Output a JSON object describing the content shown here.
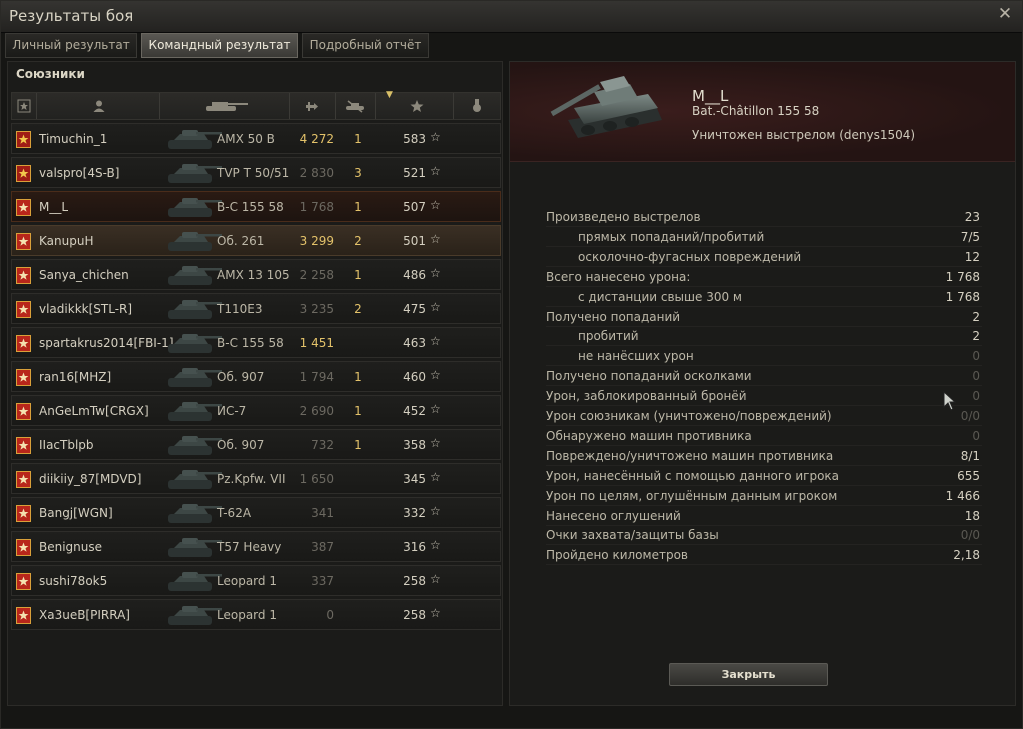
{
  "window": {
    "title": "Результаты боя",
    "close_glyph": "✕"
  },
  "tabs": [
    {
      "label": "Личный результат",
      "active": false
    },
    {
      "label": "Командный результат",
      "active": true
    },
    {
      "label": "Подробный отчёт",
      "active": false
    }
  ],
  "team": {
    "label": "Союзники",
    "columns": [
      "rank-icon",
      "player-icon",
      "tank-icon",
      "damage-icon",
      "kills-icon",
      "xp-icon",
      "medal-icon"
    ],
    "rows": [
      {
        "player": "Timuchin_1",
        "tank": "AMX 50 B",
        "damage": "4 272",
        "dmg_hi": true,
        "kills": "1",
        "xp": "583",
        "badge": "gold"
      },
      {
        "player": "valspro[4S-B]",
        "tank": "TVP T 50/51",
        "damage": "2 830",
        "dmg_hi": false,
        "kills": "3",
        "xp": "521",
        "badge": "gold"
      },
      {
        "player": "M__L",
        "tank": "B-C 155 58",
        "damage": "1 768",
        "dmg_hi": false,
        "kills": "1",
        "xp": "507",
        "badge": "red"
      },
      {
        "player": "KanupuH",
        "tank": "Об. 261",
        "damage": "3 299",
        "dmg_hi": true,
        "kills": "2",
        "xp": "501",
        "badge": "red"
      },
      {
        "player": "Sanya_chichen",
        "tank": "AMX 13 105",
        "damage": "2 258",
        "dmg_hi": false,
        "kills": "1",
        "xp": "486",
        "badge": "red"
      },
      {
        "player": "vladikkk[STL-R]",
        "tank": "T110E3",
        "damage": "3 235",
        "dmg_hi": false,
        "kills": "2",
        "xp": "475",
        "badge": "red"
      },
      {
        "player": "spartakrus2014[FBI-1]",
        "tank": "B-C 155 58",
        "damage": "1 451",
        "dmg_hi": true,
        "kills": "",
        "xp": "463",
        "badge": "red"
      },
      {
        "player": "ran16[MHZ]",
        "tank": "Об. 907",
        "damage": "1 794",
        "dmg_hi": false,
        "kills": "1",
        "xp": "460",
        "badge": "red"
      },
      {
        "player": "AnGeLmTw[CRGX]",
        "tank": "ИС-7",
        "damage": "2 690",
        "dmg_hi": false,
        "kills": "1",
        "xp": "452",
        "badge": "red"
      },
      {
        "player": "IIacTblpb",
        "tank": "Об. 907",
        "damage": "732",
        "dmg_hi": false,
        "kills": "1",
        "xp": "358",
        "badge": "red"
      },
      {
        "player": "diikiiy_87[MDVD]",
        "tank": "Pz.Kpfw. VII",
        "damage": "1 650",
        "dmg_hi": false,
        "kills": "",
        "xp": "345",
        "badge": "red"
      },
      {
        "player": "Bangj[WGN]",
        "tank": "T-62A",
        "damage": "341",
        "dmg_hi": false,
        "kills": "",
        "xp": "332",
        "badge": "red"
      },
      {
        "player": "Benignuse",
        "tank": "T57 Heavy",
        "damage": "387",
        "dmg_hi": false,
        "kills": "",
        "xp": "316",
        "badge": "red"
      },
      {
        "player": "sushi78ok5",
        "tank": "Leopard 1",
        "damage": "337",
        "dmg_hi": false,
        "kills": "",
        "xp": "258",
        "badge": "red"
      },
      {
        "player": "Xa3ueB[PIRRA]",
        "tank": "Leopard 1",
        "damage": "0",
        "dmg_hi": false,
        "kills": "",
        "xp": "258",
        "badge": "red"
      }
    ],
    "star_glyph": "☆"
  },
  "detail": {
    "player": "M__L",
    "tank": "Bat.-Châtillon 155 58",
    "status": "Уничтожен выстрелом (denys1504)",
    "stats": [
      {
        "label": "Произведено выстрелов",
        "value": "23",
        "indent": false,
        "dim": false
      },
      {
        "label": "прямых попаданий/пробитий",
        "value": "7/5",
        "indent": true,
        "dim": false
      },
      {
        "label": "осколочно-фугасных повреждений",
        "value": "12",
        "indent": true,
        "dim": false
      },
      {
        "label": "Всего нанесено урона:",
        "value": "1 768",
        "indent": false,
        "dim": false
      },
      {
        "label": "с дистанции свыше 300 м",
        "value": "1 768",
        "indent": true,
        "dim": false
      },
      {
        "label": "Получено попаданий",
        "value": "2",
        "indent": false,
        "dim": false
      },
      {
        "label": "пробитий",
        "value": "2",
        "indent": true,
        "dim": false
      },
      {
        "label": "не нанёсших урон",
        "value": "0",
        "indent": true,
        "dim": true
      },
      {
        "label": "Получено попаданий осколками",
        "value": "0",
        "indent": false,
        "dim": true
      },
      {
        "label": "Урон, заблокированный бронёй",
        "value": "0",
        "indent": false,
        "dim": true
      },
      {
        "label": "Урон союзникам (уничтожено/повреждений)",
        "value": "0/0",
        "indent": false,
        "dim": true
      },
      {
        "label": "Обнаружено машин противника",
        "value": "0",
        "indent": false,
        "dim": true
      },
      {
        "label": "Повреждено/уничтожено машин противника",
        "value": "8/1",
        "indent": false,
        "dim": false
      },
      {
        "label": "Урон, нанесённый с помощью данного игрока",
        "value": "655",
        "indent": false,
        "dim": false
      },
      {
        "label": "Урон по целям, оглушённым данным игроком",
        "value": "1 466",
        "indent": false,
        "dim": false
      },
      {
        "label": "Нанесено оглушений",
        "value": "18",
        "indent": false,
        "dim": false
      },
      {
        "label": "Очки захвата/защиты базы",
        "value": "0/0",
        "indent": false,
        "dim": true
      },
      {
        "label": "Пройдено километров",
        "value": "2,18",
        "indent": false,
        "dim": false
      }
    ],
    "close_label": "Закрыть"
  },
  "colors": {
    "gold": "#e3c26a",
    "red_badge": "#c0281d",
    "dim": "#5a5852"
  }
}
